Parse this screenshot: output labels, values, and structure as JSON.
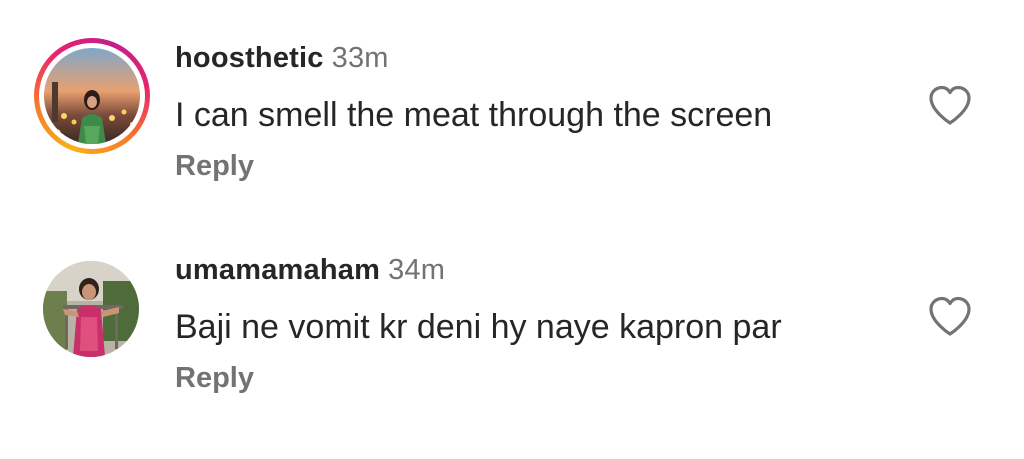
{
  "comments": [
    {
      "username": "hoosthetic",
      "timestamp": "33m",
      "text": "I can smell the meat through the screen",
      "reply_label": "Reply",
      "has_story_ring": true,
      "like_icon": "heart-outline-icon"
    },
    {
      "username": "umamamaham",
      "timestamp": "34m",
      "text": "Baji ne vomit kr deni hy naye kapron par",
      "reply_label": "Reply",
      "has_story_ring": false,
      "like_icon": "heart-outline-icon"
    }
  ],
  "colors": {
    "text_primary": "#262626",
    "text_secondary": "#737373",
    "story_ring_start": "#f9b019",
    "story_ring_end": "#c41d8f"
  }
}
